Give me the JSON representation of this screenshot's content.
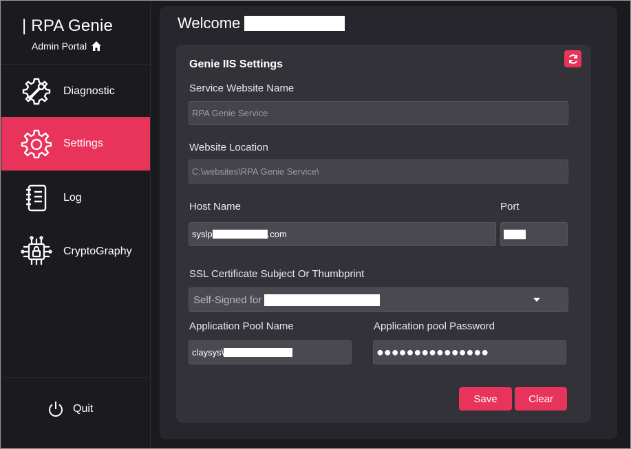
{
  "app": {
    "title": "| RPA Genie",
    "subtitle": "Admin Portal"
  },
  "sidebar": {
    "items": [
      {
        "label": "Diagnostic",
        "icon": "gear-wrench-icon",
        "active": false
      },
      {
        "label": "Settings",
        "icon": "gear-icon",
        "active": true
      },
      {
        "label": "Log",
        "icon": "notebook-icon",
        "active": false
      },
      {
        "label": "CryptoGraphy",
        "icon": "chip-lock-icon",
        "active": false
      }
    ],
    "quit_label": "Quit"
  },
  "main": {
    "welcome": "Welcome"
  },
  "card": {
    "title": "Genie IIS Settings",
    "fields": {
      "service_name_label": "Service Website Name",
      "service_name_value": "RPA Genie Service",
      "location_label": "Website Location",
      "location_value": "C:\\websites\\RPA Genie Service\\",
      "host_label": "Host Name",
      "host_prefix": "syslp",
      "host_suffix": ".com",
      "port_label": "Port",
      "ssl_label": "SSL Certificate Subject Or Thumbprint",
      "ssl_value": "Self-Signed for",
      "pool_name_label": "Application Pool Name",
      "pool_name_prefix": "claysys\\",
      "pool_password_label": "Application pool Password",
      "pool_password_value": "●●●●●●●●●●●●●●●"
    },
    "buttons": {
      "save": "Save",
      "clear": "Clear"
    }
  },
  "colors": {
    "accent": "#e8345a",
    "sidebar_bg": "#1b1a1f",
    "panel_bg": "#27262c",
    "card_bg": "#333239",
    "input_bg": "#4a4952"
  }
}
